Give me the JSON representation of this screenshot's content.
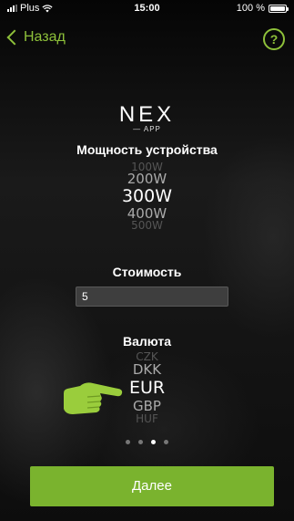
{
  "status_bar": {
    "carrier": "Plus",
    "time": "15:00",
    "battery": "100 %",
    "battery_level": 1.0
  },
  "nav": {
    "back_label": "Назад",
    "help_label": "?"
  },
  "logo": {
    "brand": "NEX",
    "sub": "APP"
  },
  "power": {
    "heading": "Мощность устройства",
    "options": [
      "100W",
      "200W",
      "300W",
      "400W",
      "500W"
    ],
    "selected_index": 2
  },
  "cost": {
    "heading": "Стоимость",
    "value": "5"
  },
  "currency": {
    "heading": "Валюта",
    "options": [
      "CZK",
      "DKK",
      "EUR",
      "GBP",
      "HUF"
    ],
    "selected_index": 2
  },
  "pager": {
    "count": 4,
    "active_index": 2
  },
  "next_button": {
    "label": "Далее"
  },
  "colors": {
    "accent": "#8ec13a",
    "button": "#7ab32e"
  }
}
